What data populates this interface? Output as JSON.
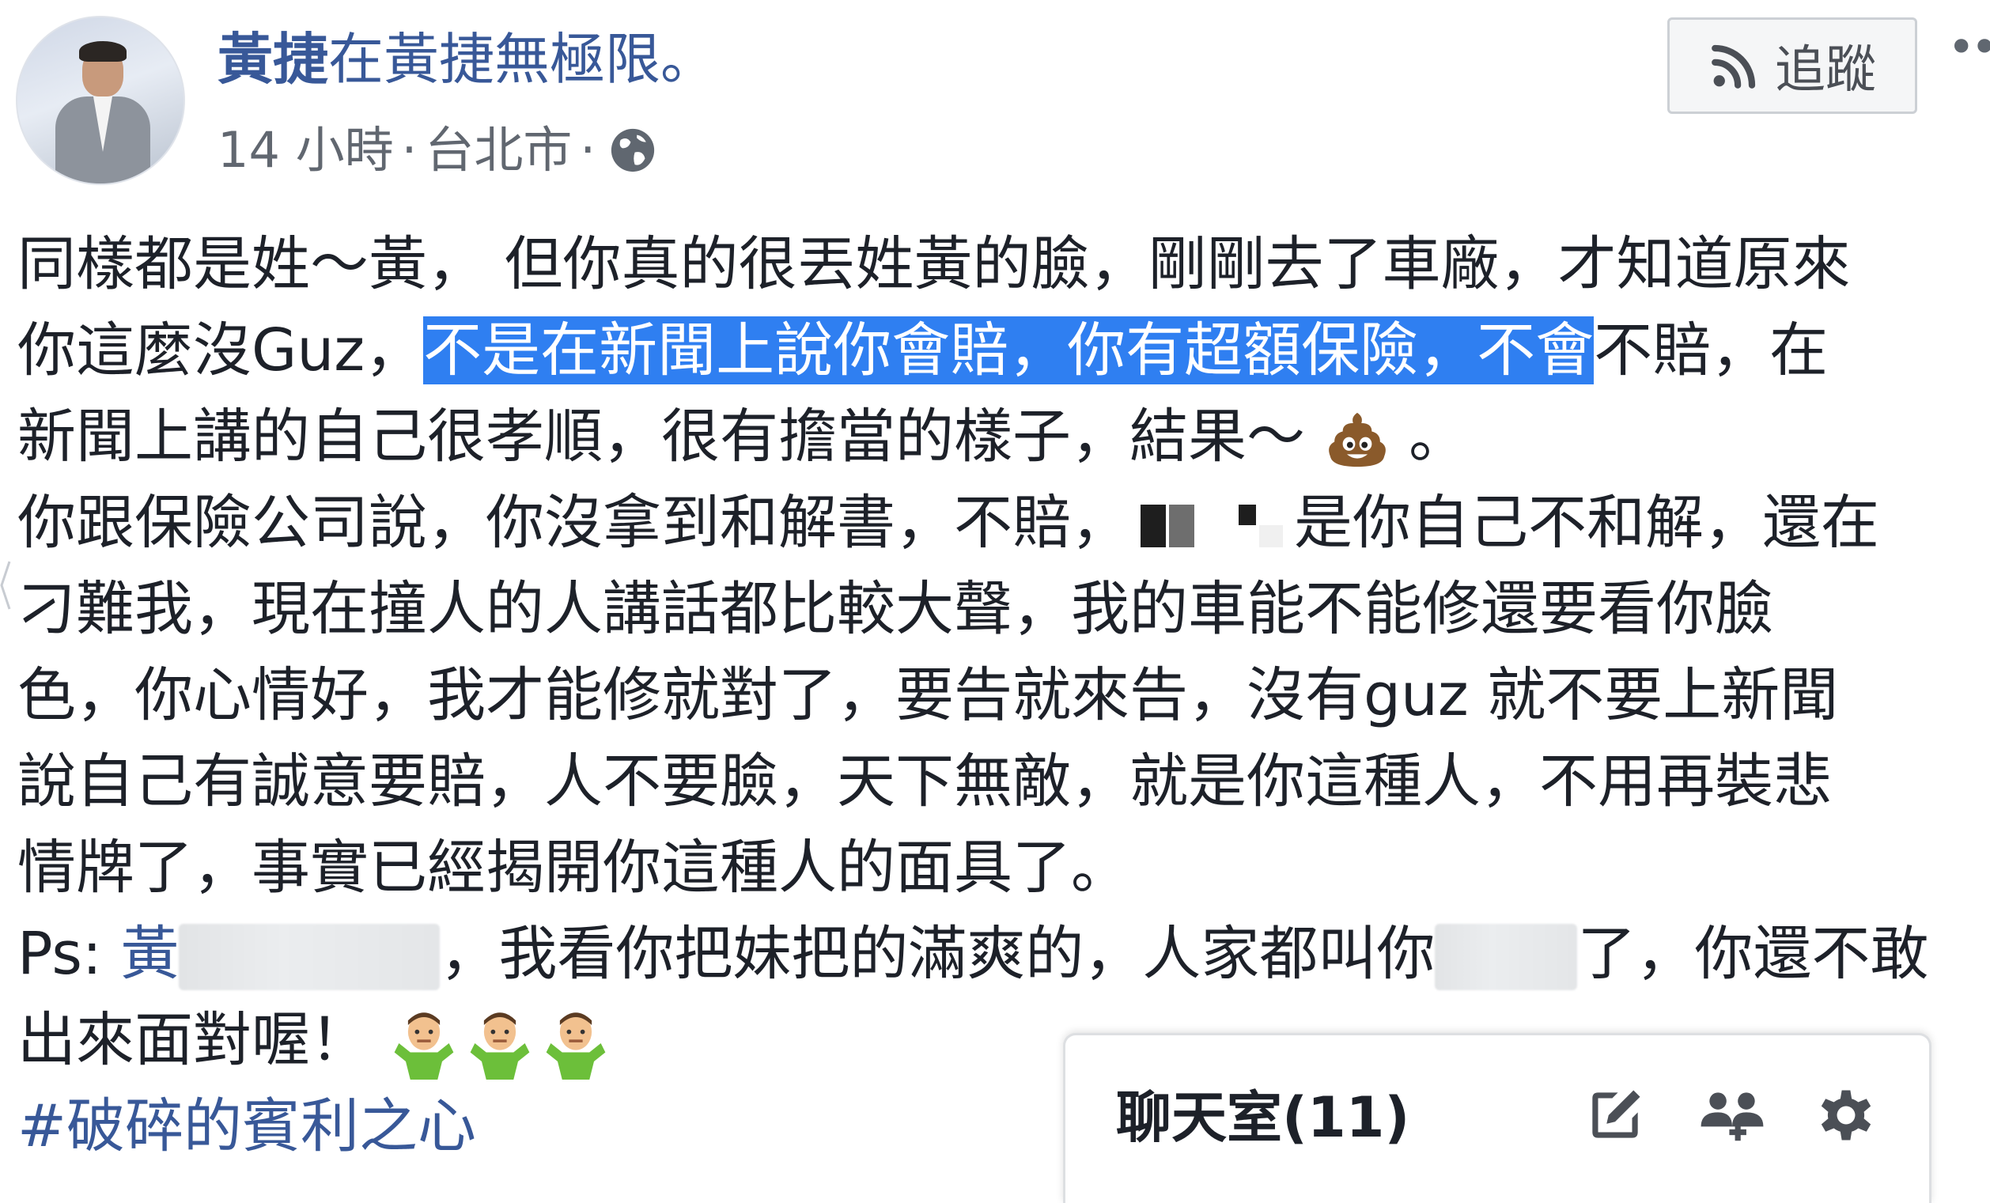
{
  "post": {
    "author": "黃捷",
    "at_text": "在",
    "page_name": "黃捷無極限",
    "period": "。",
    "time": "14 小時",
    "sep": "·",
    "location": "台北市",
    "sep2": "·",
    "follow_label": "追蹤"
  },
  "body": {
    "l1": "同樣都是姓～黃， 但你真的很丟姓黃的臉，剛剛去了車廠，才知道原來",
    "l2a": "你這麼沒Guz，",
    "l2b": "不是在新聞上說你會賠，你有超額保險，不會",
    "l2c": "不賠，在",
    "l3a": "新聞上講的自己很孝順，很有擔當的樣子，結果～",
    "l3b": "。",
    "l4a": "你跟保險公司說，你沒拿到和解書，不賠，",
    "l4b": "是你自己不和解，還在",
    "l5": "刁難我，現在撞人的人講話都比較大聲，我的車能不能修還要看你臉",
    "l6": "色，你心情好，我才能修就對了，要告就來告，沒有guz 就不要上新聞",
    "l7": "說自己有誠意要賠，人不要臉，天下無敵，就是你這種人，不用再裝悲",
    "l8": "情牌了，事實已經揭開你這種人的面具了。",
    "l9a": "Ps: ",
    "l9_mention": "黃",
    "l9b": "，我看你把妹把的滿爽的，人家都叫你",
    "l9c": "了，你還不敢",
    "l10": "出來面對喔！",
    "hashtag": "#破碎的賓利之心"
  },
  "chat": {
    "title": "聊天室(11)"
  },
  "icons": {
    "globe": "globe-icon",
    "rss": "rss-icon",
    "more": "more-icon",
    "poop": "poop-emoji-icon",
    "shrug": "man-shrugging-emoji-icon",
    "compose": "compose-icon",
    "new_group": "new-group-icon",
    "settings": "gear-icon"
  },
  "colors": {
    "link": "#385898",
    "highlight": "#2f7ff1",
    "text": "#1d2129",
    "meta": "#616770"
  }
}
